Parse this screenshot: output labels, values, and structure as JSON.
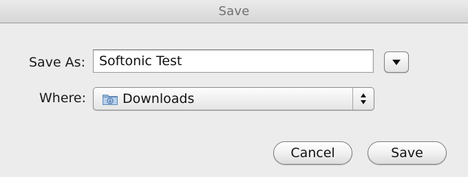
{
  "window": {
    "title": "Save"
  },
  "save_as": {
    "label": "Save As:",
    "value": "Softonic Test"
  },
  "where": {
    "label": "Where:",
    "selected": "Downloads",
    "icon": "downloads-folder-icon"
  },
  "buttons": {
    "cancel_label": "Cancel",
    "save_label": "Save"
  },
  "colors": {
    "background": "#ececec",
    "folder_icon": "#8fb4dc"
  }
}
